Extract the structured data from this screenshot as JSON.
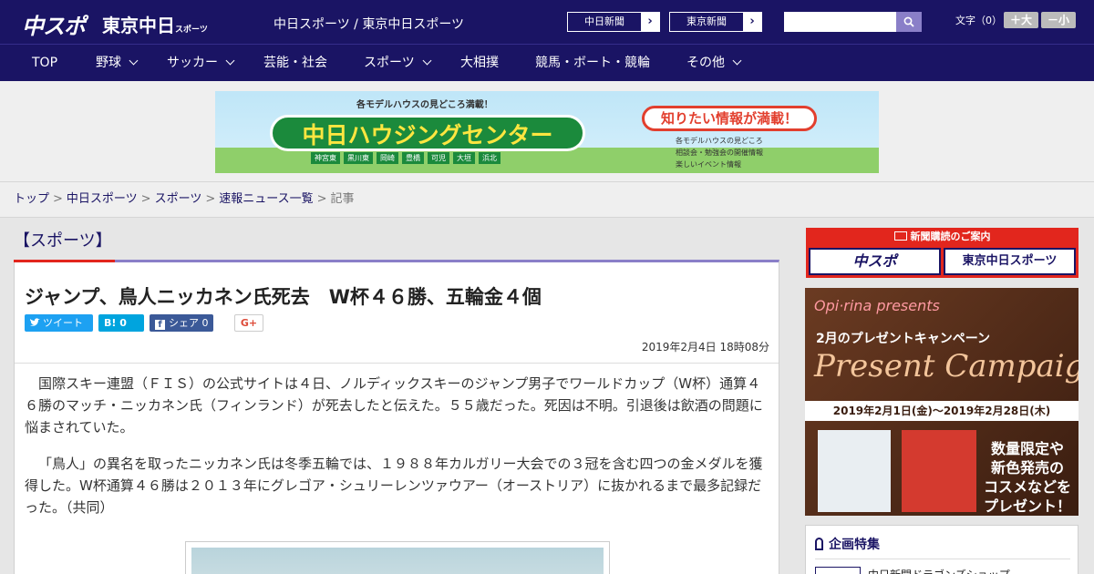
{
  "header": {
    "logo_main": "中スポ",
    "logo_sub": "東京中日",
    "logo_sub_small": "スポーツ",
    "site_name": "中日スポーツ / 東京中日スポーツ",
    "ext_links": [
      "中日新聞",
      "東京新聞"
    ],
    "ext_arrow": "›",
    "search_placeholder": "",
    "font_size_label": "文字（0）",
    "font_bigger": "＋大",
    "font_smaller": "－小"
  },
  "nav": {
    "items": [
      {
        "label": "TOP",
        "has_dropdown": false
      },
      {
        "label": "野球",
        "has_dropdown": true
      },
      {
        "label": "サッカー",
        "has_dropdown": true
      },
      {
        "label": "芸能・社会",
        "has_dropdown": false
      },
      {
        "label": "スポーツ",
        "has_dropdown": true
      },
      {
        "label": "大相撲",
        "has_dropdown": false
      },
      {
        "label": "競馬・ボート・競輪",
        "has_dropdown": false
      },
      {
        "label": "その他",
        "has_dropdown": true
      }
    ]
  },
  "banner": {
    "top_text": "各モデルハウスの見どころ満載！",
    "title": "中日ハウジングセンター",
    "slogan": "知りたい情報が満載！",
    "locations": [
      "神宮東",
      "黒川東",
      "岡崎",
      "豊橋",
      "可児",
      "大垣",
      "浜北"
    ],
    "features": [
      "各モデルハウスの見どころ",
      "相談会・勉強会の開催情報",
      "楽しいイベント情報"
    ]
  },
  "breadcrumb": {
    "items": [
      "トップ",
      "中日スポーツ",
      "スポーツ",
      "速報ニュース一覧"
    ],
    "separator": ">",
    "current": "記事"
  },
  "article": {
    "category": "【スポーツ】",
    "headline": "ジャンプ、鳥人ニッカネン氏死去　W杯４６勝、五輪金４個",
    "share": {
      "tweet": "ツイート",
      "hatena": "B! 0",
      "facebook": "シェア 0",
      "gplus": "G+"
    },
    "date": "2019年2月4日 18時08分",
    "paragraphs": [
      "国際スキー連盟（ＦＩＳ）の公式サイトは４日、ノルディックスキーのジャンプ男子でワールドカップ（W杯）通算４６勝のマッチ・ニッカネン氏（フィンランド）が死去したと伝えた。５５歳だった。死因は不明。引退後は飲酒の問題に悩まされていた。",
      "「鳥人」の異名を取ったニッカネン氏は冬季五輪では、１９８８年カルガリー大会での３冠を含む四つの金メダルを獲得した。W杯通算４６勝は２０１３年にグレゴア・シュリーレンツァウアー（オーストリア）に抜かれるまで最多記録だった。（共同）"
    ]
  },
  "sidebar": {
    "subscribe_header": "新聞購読のご案内",
    "subscribe_options": [
      "中スポ",
      "東京中日スポーツ"
    ],
    "promo": {
      "brand": "Opi·rina presents",
      "campaign": "2月のプレゼントキャンペーン",
      "headline": "Present Campaign",
      "period": "2019年2月1日(金)～2019年2月28日(木)",
      "limited": "数量限定や\n新色発売の\nコスメなどを\nプレゼント！"
    },
    "feature_title": "企画特集",
    "feature_item": "中日新聞ドラゴンズショップ"
  },
  "colors": {
    "primary": "#1a1464",
    "accent_red": "#e2261d",
    "accent_purple": "#8a7fc8",
    "twitter": "#1da1f2",
    "hatena": "#00a4de",
    "facebook": "#3b5998"
  }
}
